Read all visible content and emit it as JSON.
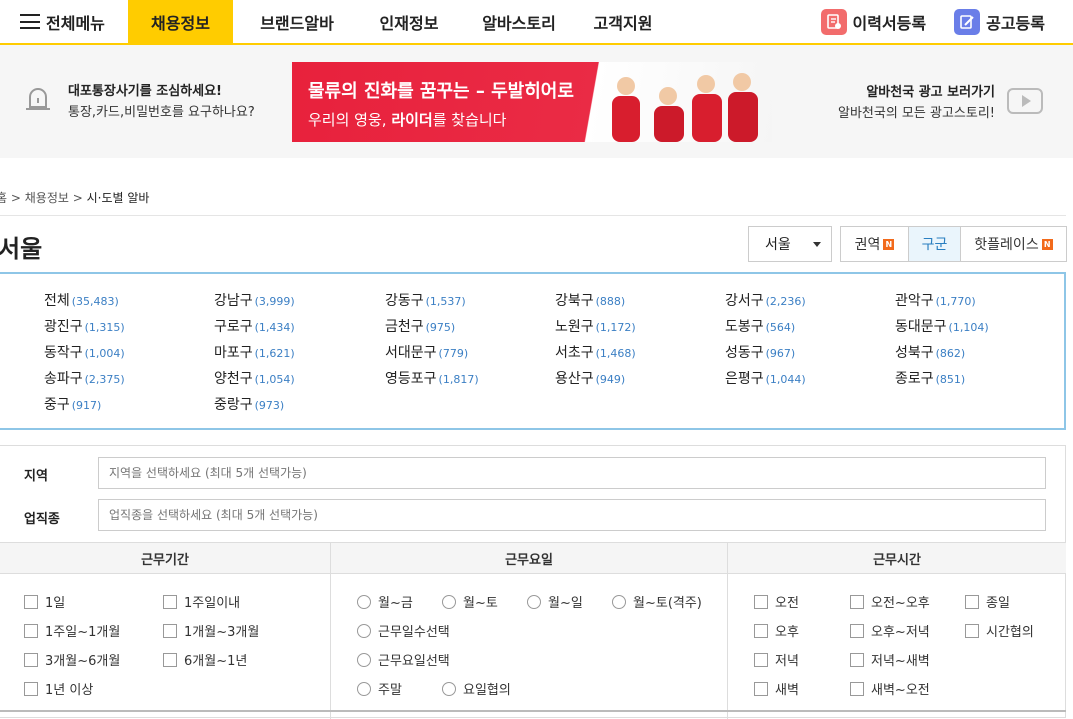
{
  "nav": {
    "menu_all": "전체메뉴",
    "tabs": [
      "채용정보",
      "브랜드알바",
      "인재정보",
      "알바스토리",
      "고객지원"
    ],
    "active_tab": "채용정보",
    "resume_label": "이력서등록",
    "post_label": "공고등록"
  },
  "banner": {
    "fraud_line1": "대포통장사기를 조심하세요!",
    "fraud_line2": "통장,카드,비밀번호를 요구하나요?",
    "ad_line1": "물류의 진화를 꿈꾸는 – 두발히어로",
    "ad_line2_pre": "우리의 영웅, ",
    "ad_line2_bold": "라이더",
    "ad_line2_post": "를 찾습니다",
    "adlink_line1": "알바천국 광고 보러가기",
    "adlink_line2": "알바천국의 모든 광고스토리!"
  },
  "breadcrumb": {
    "home": "홈",
    "sep": " > ",
    "level1": "채용정보",
    "current": "시·도별 알바"
  },
  "page_title": "서울",
  "city_select": "서울",
  "region_tabs": [
    {
      "label": "권역",
      "badge": "N"
    },
    {
      "label": "구군",
      "badge": ""
    },
    {
      "label": "핫플레이스",
      "badge": "N"
    }
  ],
  "districts": [
    {
      "name": "전체",
      "count": "(35,483)"
    },
    {
      "name": "강남구",
      "count": "(3,999)"
    },
    {
      "name": "강동구",
      "count": "(1,537)"
    },
    {
      "name": "강북구",
      "count": "(888)"
    },
    {
      "name": "강서구",
      "count": "(2,236)"
    },
    {
      "name": "관악구",
      "count": "(1,770)"
    },
    {
      "name": "광진구",
      "count": "(1,315)"
    },
    {
      "name": "구로구",
      "count": "(1,434)"
    },
    {
      "name": "금천구",
      "count": "(975)"
    },
    {
      "name": "노원구",
      "count": "(1,172)"
    },
    {
      "name": "도봉구",
      "count": "(564)"
    },
    {
      "name": "동대문구",
      "count": "(1,104)"
    },
    {
      "name": "동작구",
      "count": "(1,004)"
    },
    {
      "name": "마포구",
      "count": "(1,621)"
    },
    {
      "name": "서대문구",
      "count": "(779)"
    },
    {
      "name": "서초구",
      "count": "(1,468)"
    },
    {
      "name": "성동구",
      "count": "(967)"
    },
    {
      "name": "성북구",
      "count": "(862)"
    },
    {
      "name": "송파구",
      "count": "(2,375)"
    },
    {
      "name": "양천구",
      "count": "(1,054)"
    },
    {
      "name": "영등포구",
      "count": "(1,817)"
    },
    {
      "name": "용산구",
      "count": "(949)"
    },
    {
      "name": "은평구",
      "count": "(1,044)"
    },
    {
      "name": "종로구",
      "count": "(851)"
    },
    {
      "name": "중구",
      "count": "(917)"
    },
    {
      "name": "중랑구",
      "count": "(973)"
    }
  ],
  "filters": {
    "region_label": "지역",
    "region_placeholder": "지역을 선택하세요 (최대 5개 선택가능)",
    "job_label": "업직종",
    "job_placeholder": "업직종을 선택하세요 (최대 5개 선택가능)",
    "period_header": "근무기간",
    "days_header": "근무요일",
    "time_header": "근무시간",
    "period_options": [
      "1일",
      "1주일이내",
      "1주일~1개월",
      "1개월~3개월",
      "3개월~6개월",
      "6개월~1년",
      "1년 이상"
    ],
    "days_options": [
      "월~금",
      "월~토",
      "월~일",
      "월~토(격주)",
      "근무일수선택",
      "근무요일선택",
      "주말",
      "요일협의"
    ],
    "time_options": [
      "오전",
      "오전~오후",
      "종일",
      "오후",
      "오후~저녁",
      "시간협의",
      "저녁",
      "저녁~새벽",
      "새벽",
      "새벽~오전"
    ]
  },
  "colors": {
    "brand_yellow": "#ffcc00",
    "link_blue": "#3b7fc4",
    "ad_red": "#e8213c",
    "badge_orange": "#f26a1b"
  }
}
